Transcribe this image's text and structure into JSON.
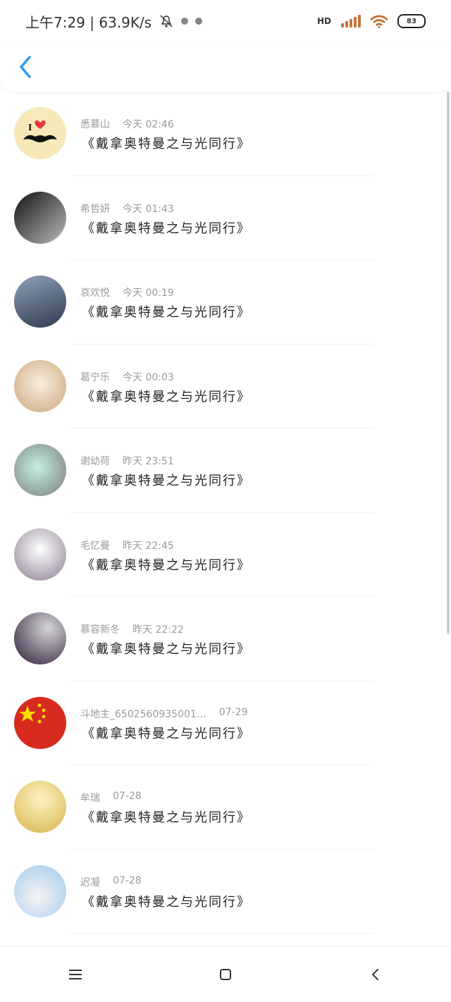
{
  "status_bar": {
    "time_speed": "上午7:29 | 63.9K/s",
    "hd_label": "HD",
    "battery": "83"
  },
  "header": {
    "back_icon": "chevron-left-icon"
  },
  "items": [
    {
      "name": "悉慕山",
      "time": "今天 02:46",
      "message": "《戴拿奥特曼之与光同行》",
      "avatar_color": "#f6e8b8"
    },
    {
      "name": "希哲妍",
      "time": "今天 01:43",
      "message": "《戴拿奥特曼之与光同行》",
      "avatar_color": "#6a6a6a"
    },
    {
      "name": "哀欢悦",
      "time": "今天 00:19",
      "message": "《戴拿奥特曼之与光同行》",
      "avatar_color": "#4c5b74"
    },
    {
      "name": "葛宁乐",
      "time": "今天 00:03",
      "message": "《戴拿奥特曼之与光同行》",
      "avatar_color": "#e7d3b2"
    },
    {
      "name": "谢幼荷",
      "time": "昨天 23:51",
      "message": "《戴拿奥特曼之与光同行》",
      "avatar_color": "#a7d3c6"
    },
    {
      "name": "毛忆曼",
      "time": "昨天 22:45",
      "message": "《戴拿奥特曼之与光同行》",
      "avatar_color": "#d7d0da"
    },
    {
      "name": "慕容新冬",
      "time": "昨天 22:22",
      "message": "《戴拿奥特曼之与光同行》",
      "avatar_color": "#3a2b45"
    },
    {
      "name": "斗地主_6502560935001…",
      "time": "07-29",
      "message": "《戴拿奥特曼之与光同行》",
      "avatar_color": "#d62b1e"
    },
    {
      "name": "牟瑞",
      "time": "07-28",
      "message": "《戴拿奥特曼之与光同行》",
      "avatar_color": "#f2d36d"
    },
    {
      "name": "迟凝",
      "time": "07-28",
      "message": "《戴拿奥特曼之与光同行》",
      "avatar_color": "#b8d8f0"
    }
  ],
  "bottom_nav": {
    "menu_icon": "menu-icon",
    "home_icon": "home-icon",
    "back_icon": "back-icon"
  }
}
